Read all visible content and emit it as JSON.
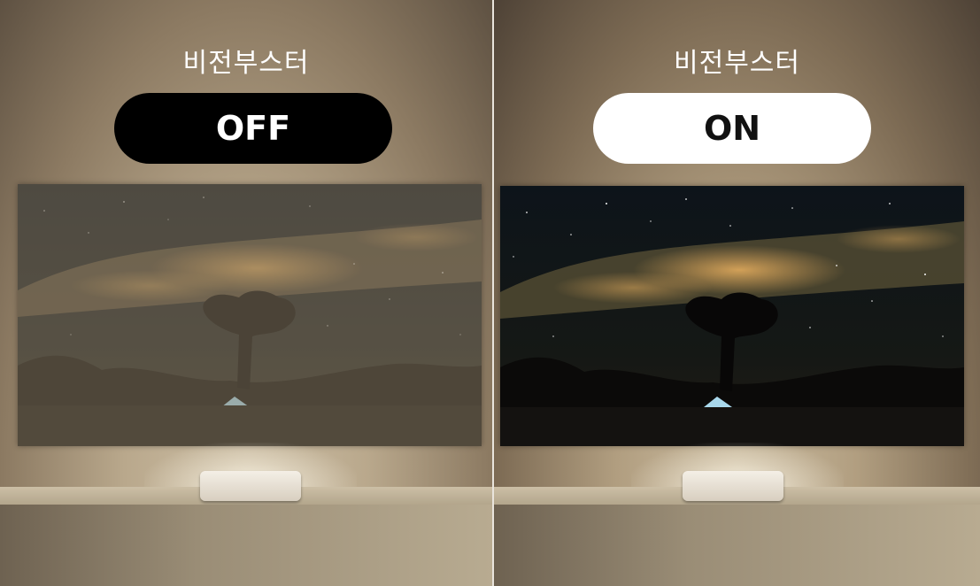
{
  "panels": {
    "left": {
      "title": "비전부스터",
      "toggle_label": "OFF",
      "state": "off"
    },
    "right": {
      "title": "비전부스터",
      "toggle_label": "ON",
      "state": "on"
    }
  },
  "scene": {
    "subject": "milky-way-night-sky-with-tree-and-tent",
    "colors": {
      "pill_off_bg": "#000000",
      "pill_on_bg": "#ffffff"
    }
  }
}
